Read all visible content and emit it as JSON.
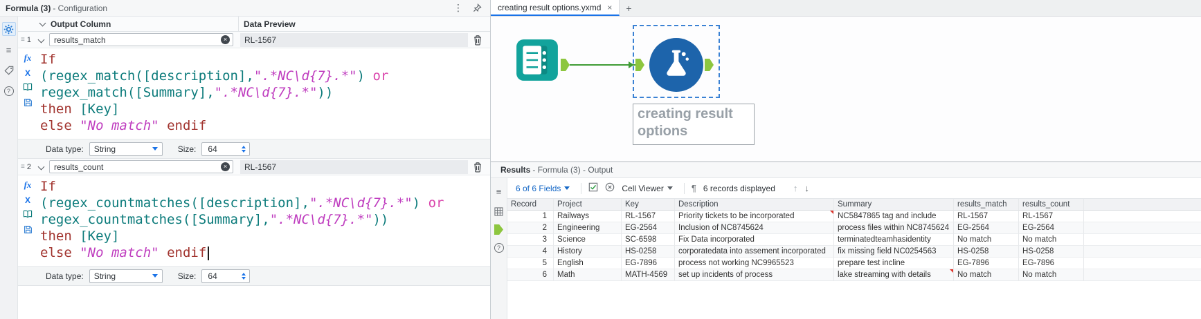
{
  "icons": {
    "kebab": "⋮",
    "drag": "≡",
    "close": "×",
    "plus": "+",
    "clear": "×",
    "paragraph": "¶",
    "arrow_up": "↑",
    "arrow_down": "↓",
    "help": "?",
    "fx": "fx",
    "x_var": "X"
  },
  "config": {
    "title_bold": "Formula (3)",
    "title_rest": "- Configuration",
    "output_column_header": "Output Column",
    "data_preview_header": "Data Preview",
    "data_type_label": "Data type:",
    "size_label": "Size:",
    "expressions": [
      {
        "num": "1",
        "output_column": "results_match",
        "preview": "RL-1567",
        "data_type": "String",
        "size": "64",
        "code": [
          [
            [
              "kw",
              "If"
            ]
          ],
          [
            [
              "fn",
              "(regex_match([description],"
            ],
            [
              "str",
              "\".*NC\\d{7}.*\""
            ],
            [
              "fn",
              ")"
            ],
            [
              "pl",
              " "
            ],
            [
              "op",
              "or"
            ]
          ],
          [
            [
              "fn",
              "regex_match([Summary],"
            ],
            [
              "str",
              "\".*NC\\d{7}.*\""
            ],
            [
              "fn",
              "))"
            ]
          ],
          [
            [
              "kw",
              "then"
            ],
            [
              "pl",
              " "
            ],
            [
              "fn",
              "[Key]"
            ]
          ],
          [
            [
              "kw",
              "else"
            ],
            [
              "pl",
              " "
            ],
            [
              "str",
              "\"No match\""
            ],
            [
              "pl",
              " "
            ],
            [
              "kw",
              "endif"
            ]
          ]
        ]
      },
      {
        "num": "2",
        "output_column": "results_count",
        "preview": "RL-1567",
        "data_type": "String",
        "size": "64",
        "code": [
          [
            [
              "kw",
              "If"
            ]
          ],
          [
            [
              "fn",
              "(regex_countmatches([description],"
            ],
            [
              "str",
              "\".*NC\\d{7}.*\""
            ],
            [
              "fn",
              ")"
            ],
            [
              "pl",
              " "
            ],
            [
              "op",
              "or"
            ]
          ],
          [
            [
              "fn",
              "regex_countmatches([Summary],"
            ],
            [
              "str",
              "\".*NC\\d{7}.*\""
            ],
            [
              "fn",
              "))"
            ]
          ],
          [
            [
              "kw",
              "then"
            ],
            [
              "pl",
              " "
            ],
            [
              "fn",
              "[Key]"
            ]
          ],
          [
            [
              "kw",
              "else"
            ],
            [
              "pl",
              " "
            ],
            [
              "str",
              "\"No match\""
            ],
            [
              "pl",
              " "
            ],
            [
              "kw",
              "endif"
            ],
            [
              "caret",
              ""
            ]
          ]
        ]
      }
    ]
  },
  "canvas": {
    "tab_title": "creating result options.yxmd",
    "tool_label": "creating result options"
  },
  "results": {
    "title_bold": "Results",
    "title_rest": "- Formula (3) - Output",
    "fields_summary": "6 of 6 Fields",
    "cell_viewer_label": "Cell Viewer",
    "records_label": "6 records displayed",
    "table": {
      "headers": [
        "Record",
        "Project",
        "Key",
        "Description",
        "Summary",
        "results_match",
        "results_count"
      ],
      "rows": [
        [
          "1",
          "Railways",
          "RL-1567",
          "Priority tickets to be incorporated",
          "NC5847865 tag and include",
          "RL-1567",
          "RL-1567"
        ],
        [
          "2",
          "Engineering",
          "EG-2564",
          "Inclusion of NC8745624",
          "process files within NC8745624",
          "EG-2564",
          "EG-2564"
        ],
        [
          "3",
          "Science",
          "SC-6598",
          "Fix Data incorporated",
          "terminatedteamhasidentity",
          "No match",
          "No match"
        ],
        [
          "4",
          "History",
          "HS-0258",
          "corporatedata into assement incorporated",
          "fix missing field NC0254563",
          "HS-0258",
          "HS-0258"
        ],
        [
          "5",
          "English",
          "EG-7896",
          "process not working NC9965523",
          "prepare test incline",
          "EG-7896",
          "EG-7896"
        ],
        [
          "6",
          "Math",
          "MATH-4569",
          "set up incidents of process",
          "lake streaming with details",
          "No match",
          "No match"
        ]
      ],
      "flags": [
        [
          0,
          3
        ],
        [
          5,
          4
        ]
      ]
    }
  }
}
